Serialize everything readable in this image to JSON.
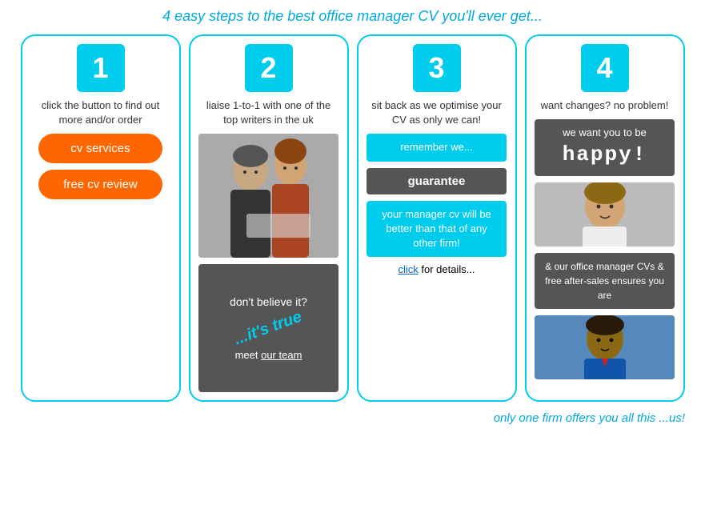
{
  "page": {
    "title": "4 easy steps to the best office manager CV you'll ever get...",
    "bottom_text": "only one firm offers you all this ...us!"
  },
  "col1": {
    "step": "1",
    "desc": "click the button to find out more and/or order",
    "btn1": "cv services",
    "btn2": "free cv review"
  },
  "col2": {
    "step": "2",
    "desc": "liaise 1-to-1 with one of the top writers in the uk",
    "dont_believe": "don't believe it?",
    "its_true": "...it's true",
    "meet_label": "meet ",
    "meet_link": "our team"
  },
  "col3": {
    "step": "3",
    "desc": "sit back as we optimise your CV as only we can!",
    "remember": "remember we...",
    "guarantee": "guarantee",
    "manager_cv": "your manager cv will be better than that of any other firm!",
    "click_text": "click",
    "for_details": " for details..."
  },
  "col4": {
    "step": "4",
    "desc": "want changes? no problem!",
    "we_want": "we want you to be",
    "happy": "happy!",
    "office_cvs": "& our office manager CVs & free after-sales ensures you are"
  }
}
